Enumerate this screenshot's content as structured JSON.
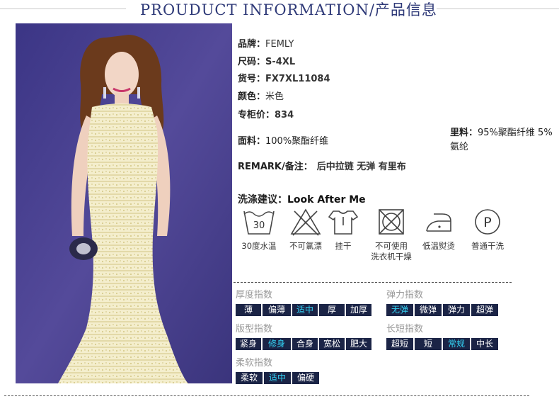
{
  "header": {
    "title": "PROUDUCT INFORMATION/产品信息"
  },
  "specs": [
    {
      "label": "品牌：",
      "value": "FEMLY"
    },
    {
      "label": "尺码：",
      "value": "S-4XL"
    },
    {
      "label": "货号：",
      "value": "FX7XL11084"
    },
    {
      "label": "颜色：",
      "value": "米色"
    },
    {
      "label": "专柜价：",
      "value": "834"
    }
  ],
  "fabric": {
    "label": "面料：",
    "value": "100%聚酯纤维"
  },
  "lining": {
    "label": "里料：",
    "value": "95%聚酯纤维 5%",
    "value2": "氨纶"
  },
  "remark": {
    "label": "REMARK/备注：",
    "value": "后中拉链 无弹 有里布"
  },
  "wash": {
    "label": "洗涤建议：",
    "value": "Look After Me"
  },
  "care_icons": [
    {
      "icon": "wash-30-icon",
      "number": "30",
      "label": "30度水温"
    },
    {
      "icon": "no-bleach-icon",
      "label": "不可氯漂"
    },
    {
      "icon": "hang-dry-icon",
      "label": "挂干"
    },
    {
      "icon": "no-tumble-dry-icon",
      "label": "不可使用",
      "label2": "洗衣机干燥"
    },
    {
      "icon": "low-iron-icon",
      "label": "低温熨烫"
    },
    {
      "icon": "dry-clean-p-icon",
      "letter": "P",
      "label": "普通干洗"
    }
  ],
  "indices": {
    "thickness": {
      "title": "厚度指数",
      "options": [
        "薄",
        "偏薄",
        "适中",
        "厚",
        "加厚"
      ],
      "selected": 2
    },
    "elasticity": {
      "title": "弹力指数",
      "options": [
        "无弹",
        "微弹",
        "弹力",
        "超弹"
      ],
      "selected": 0
    },
    "fit": {
      "title": "版型指数",
      "options": [
        "紧身",
        "修身",
        "合身",
        "宽松",
        "肥大"
      ],
      "selected": 1
    },
    "length": {
      "title": "长短指数",
      "options": [
        "超短",
        "短",
        "常规",
        "中长"
      ],
      "selected": 2
    },
    "softness": {
      "title": "柔软指数",
      "options": [
        "柔软",
        "适中",
        "偏硬"
      ],
      "selected": 1
    }
  },
  "colors": {
    "title": "#2f3a78",
    "chip_bg": "#1b2446",
    "chip_selected_text": "#33d1f3",
    "photo_bg": "#4a3f8c",
    "dress": "#f3ecc8"
  }
}
